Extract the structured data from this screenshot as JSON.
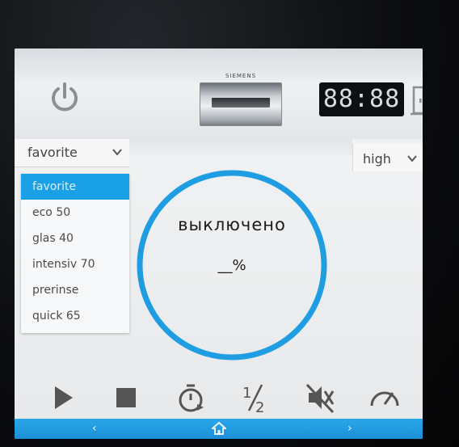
{
  "brand": "SIEMENS",
  "clock": "88:88",
  "program_select": {
    "value": "favorite"
  },
  "level_select": {
    "value": "high"
  },
  "program_menu": [
    {
      "label": "favorite",
      "selected": true
    },
    {
      "label": "eco 50",
      "selected": false
    },
    {
      "label": "glas 40",
      "selected": false
    },
    {
      "label": "intensiv 70",
      "selected": false
    },
    {
      "label": "prerinse",
      "selected": false
    },
    {
      "label": "quick 65",
      "selected": false
    }
  ],
  "status": {
    "text": "выключено",
    "percent": "__%"
  },
  "controls": [
    "play-icon",
    "stop-icon",
    "timer-icon",
    "half-load-icon",
    "mute-icon",
    "speed-gauge-icon"
  ],
  "nav": {
    "left": "‹",
    "right": "›"
  },
  "colors": {
    "accent": "#1aa0e6",
    "ring": "#1e9de3"
  }
}
